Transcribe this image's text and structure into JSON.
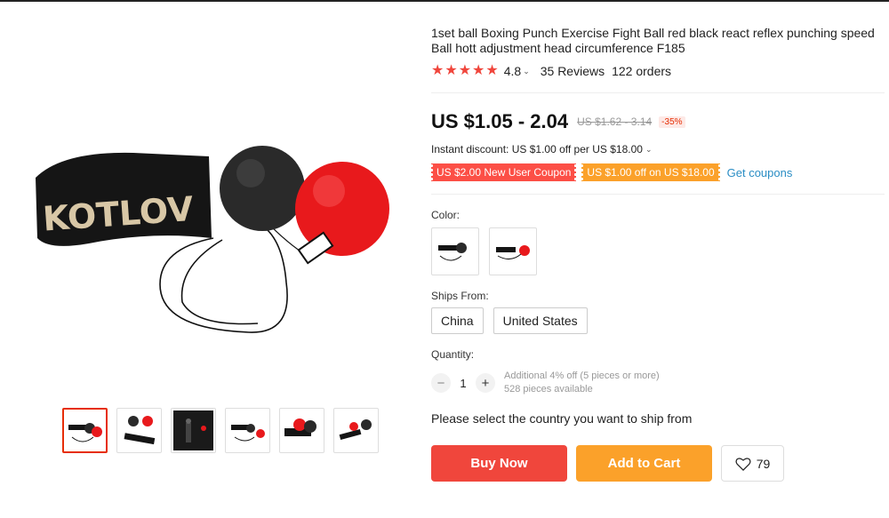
{
  "product": {
    "title": "1set ball Boxing Punch Exercise Fight Ball red black react reflex punching speed Ball hott adjustment head circumference F185",
    "rating": "4.8",
    "reviews": "35 Reviews",
    "orders": "122 orders",
    "star_count": 5,
    "band_text": "KOTLOV"
  },
  "pricing": {
    "price": "US $1.05 - 2.04",
    "original_price": "US $1.62 - 3.14",
    "discount": "-35%",
    "instant_discount": "Instant discount: US $1.00 off per US $18.00"
  },
  "coupons": {
    "new_user": "US $2.00 New User Coupon",
    "store": "US $1.00 off on US $18.00",
    "get_label": "Get coupons"
  },
  "options": {
    "color_label": "Color:",
    "ships_from_label": "Ships From:",
    "ships_from": [
      "China",
      "United States"
    ],
    "quantity_label": "Quantity:",
    "quantity_value": "1",
    "quantity_minus": "−",
    "quantity_plus": "+",
    "bulk_discount": "Additional 4% off (5 pieces or more)",
    "available": "528 pieces available"
  },
  "shipping_note": "Please select the country you want to ship from",
  "actions": {
    "buy_now": "Buy Now",
    "add_to_cart": "Add to Cart",
    "wishlist_count": "79"
  },
  "colors": {
    "accent_red": "#f0463c",
    "accent_orange": "#fba12a",
    "link_blue": "#2a8dc4"
  }
}
